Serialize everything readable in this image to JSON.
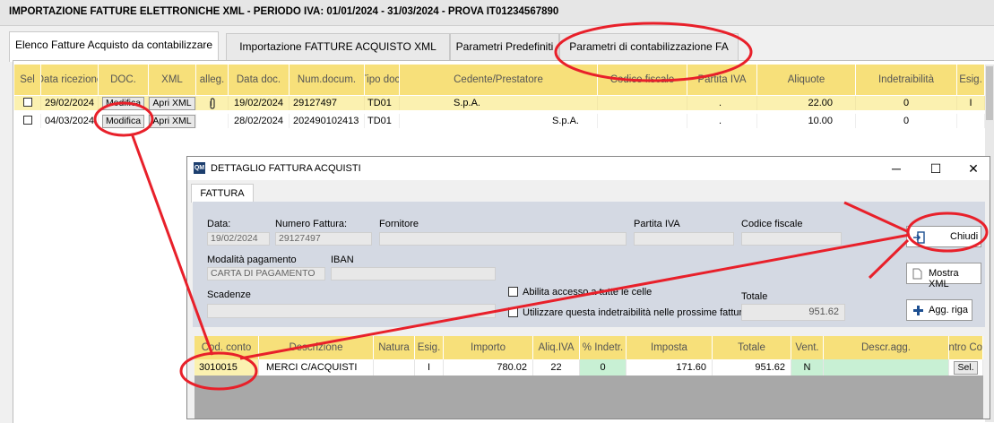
{
  "app": {
    "title": "IMPORTAZIONE FATTURE ELETTRONICHE XML - PERIODO IVA: 01/01/2024 - 31/03/2024 - PROVA IT01234567890"
  },
  "tabs": [
    {
      "label": "Elenco Fatture Acquisto da contabilizzare"
    },
    {
      "label": "Importazione FATTURE ACQUISTO XML"
    },
    {
      "label": "Parametri Predefiniti"
    },
    {
      "label": "Parametri di contabilizzazione FA"
    }
  ],
  "grid": {
    "headers": [
      "Sel",
      "Data ricezione",
      "DOC.",
      "XML",
      "alleg.",
      "Data doc.",
      "Num.docum.",
      "Tipo doc.",
      "Cedente/Prestatore",
      "Codice fiscale",
      "Partita IVA",
      "Aliquote",
      "Indetraibilità",
      "Esig."
    ],
    "modifica_label": "Modifica",
    "apri_label": "Apri XML",
    "rows": [
      {
        "data_ric": "29/02/2024",
        "data_doc": "19/02/2024",
        "num": "29127497",
        "tipo": "TD01",
        "cedente": "S.p.A.",
        "cf": "",
        "piva": ".",
        "aliquote": "22.00",
        "indetr": "0",
        "esig": "I"
      },
      {
        "data_ric": "04/03/2024",
        "data_doc": "28/02/2024",
        "num": "202490102413",
        "tipo": "TD01",
        "cedente": "S.p.A.",
        "cf": "",
        "piva": ".",
        "aliquote": "10.00",
        "indetr": "0",
        "esig": ""
      }
    ]
  },
  "dialog": {
    "title": "DETTAGLIO FATTURA ACQUISTI",
    "tab": "FATTURA",
    "labels": {
      "data": "Data:",
      "numero": "Numero Fattura:",
      "fornitore": "Fornitore",
      "partita_iva": "Partita IVA",
      "codice_fiscale": "Codice fiscale",
      "modalita": "Modalità pagamento",
      "iban": "IBAN",
      "scadenze": "Scadenze",
      "abilita": "Abilita accesso a tutte le celle",
      "utilizzare": "Utilizzare questa indetraibilità nelle prossime fatture",
      "totale": "Totale"
    },
    "values": {
      "data": "19/02/2024",
      "numero": "29127497",
      "modalita": "CARTA DI PAGAMENTO",
      "totale": "951.62"
    },
    "buttons": {
      "chiudi": "Chiudi",
      "mostra_xml": "Mostra XML",
      "agg_riga": "Agg. riga"
    },
    "detail_headers": [
      "Cod. conto",
      "Descrizione",
      "Natura",
      "Esig.",
      "Importo",
      "Aliq.IVA",
      "% Indetr.",
      "Imposta",
      "Totale",
      "Vent.",
      "Descr.agg.",
      "Centro Costo"
    ],
    "detail_row": {
      "conto": "3010015",
      "descrizione": "MERCI C/ACQUISTI",
      "natura": "",
      "esig": "I",
      "importo": "780.02",
      "aliq": "22",
      "indetr": "0",
      "imposta": "171.60",
      "totale": "951.62",
      "vent": "N",
      "descr_agg": "",
      "centro": "Sel."
    }
  },
  "colors": {
    "header": "#f7e07a",
    "selected_row": "#fbf1b0",
    "annotation": "#e8202a",
    "form_bg": "#d4d9e3",
    "green_cell": "#c8f0d4"
  }
}
